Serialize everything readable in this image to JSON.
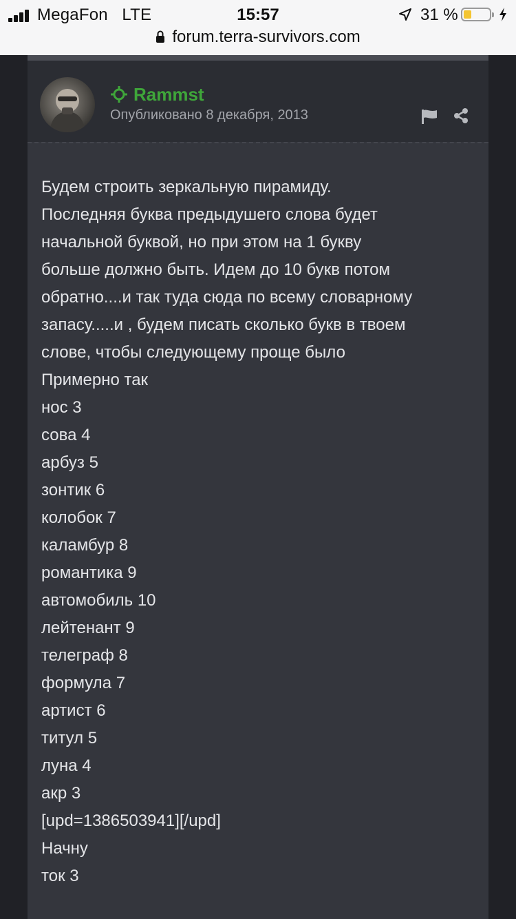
{
  "status_bar": {
    "carrier": "MegaFon",
    "network": "LTE",
    "time": "15:57",
    "battery_percent": "31 %",
    "battery_level": 0.31,
    "icons": [
      "signal-icon",
      "location-arrow-icon",
      "battery-icon",
      "charging-bolt-icon"
    ]
  },
  "browser": {
    "url": "forum.terra-survivors.com",
    "lock_icon": "lock-icon"
  },
  "post": {
    "author": "Rammst",
    "author_icon": "crosshair-icon",
    "published": "Опубликовано 8 декабря, 2013",
    "actions": [
      "flag-icon",
      "share-icon"
    ],
    "colors": {
      "author": "#3fa63a",
      "background": "#34363d",
      "header": "#2b2d33"
    },
    "body_lines": [
      "Будем строить зеркальную пирамиду.",
      "Последняя буква предыдушего слова будет",
      "начальной буквой, но при этом на 1 букву",
      "больше должно быть. Идем до 10 букв потом",
      "обратно....и так туда сюда по всему словарному",
      "запасу.....и , будем писать сколько букв в твоем",
      "слове, чтобы следующему проще было",
      "Примерно так",
      "нос 3",
      "сова 4",
      "арбуз 5",
      "зонтик 6",
      "колобок 7",
      "каламбур 8",
      "романтика 9",
      "автомобиль 10",
      "лейтенант 9",
      "телеграф 8",
      "формула 7",
      "артист 6",
      "титул 5",
      "луна 4",
      "акр 3",
      "[upd=1386503941][/upd]",
      "Начну",
      "ток 3"
    ]
  }
}
